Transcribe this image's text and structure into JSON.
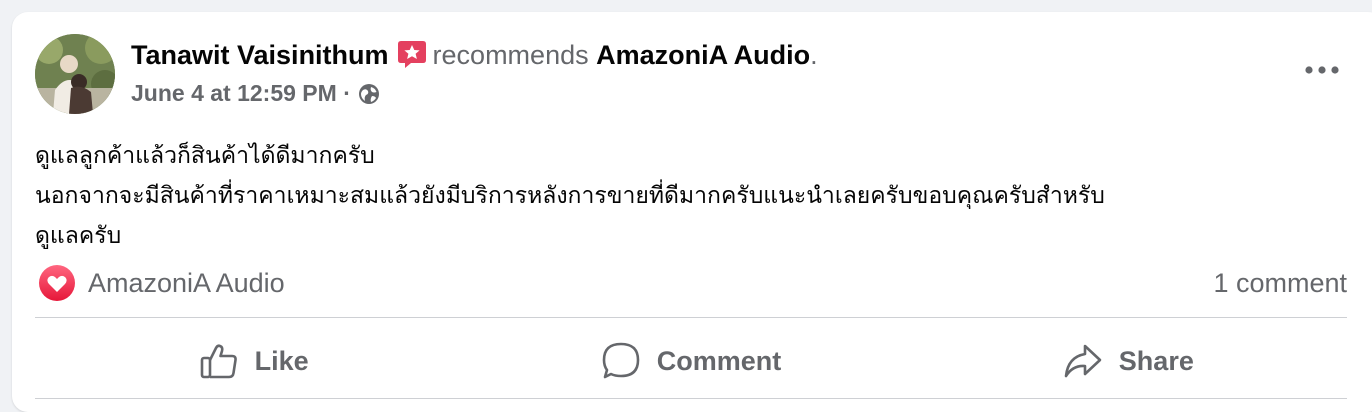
{
  "post": {
    "author": "Tanawit Vaisinithum",
    "recommends_text": "recommends",
    "page_name": "AmazoniA Audio",
    "period": ".",
    "timestamp": "June 4 at 12:59 PM",
    "separator": "·",
    "privacy_icon": "globe-icon",
    "more_icon": "more-options-icon",
    "body_lines": [
      "ดูแลลูกค้าแล้วก็สินค้าได้ดีมากครับ",
      "นอกจากจะมีสินค้าที่ราคาเหมาะสมแล้วยังมีบริการหลังการขายที่ดีมากครับแนะนำเลยครับขอบคุณครับสำหรับ",
      "ดูแลครับ"
    ]
  },
  "reactions": {
    "icon": "love-icon",
    "name": "AmazoniA Audio",
    "comment_count": "1 comment"
  },
  "actions": {
    "like": "Like",
    "comment": "Comment",
    "share": "Share"
  },
  "colors": {
    "recommend_badge": "#e4405f",
    "love": "#f33e58",
    "secondary_text": "#65676b",
    "divider": "#ced0d4"
  }
}
